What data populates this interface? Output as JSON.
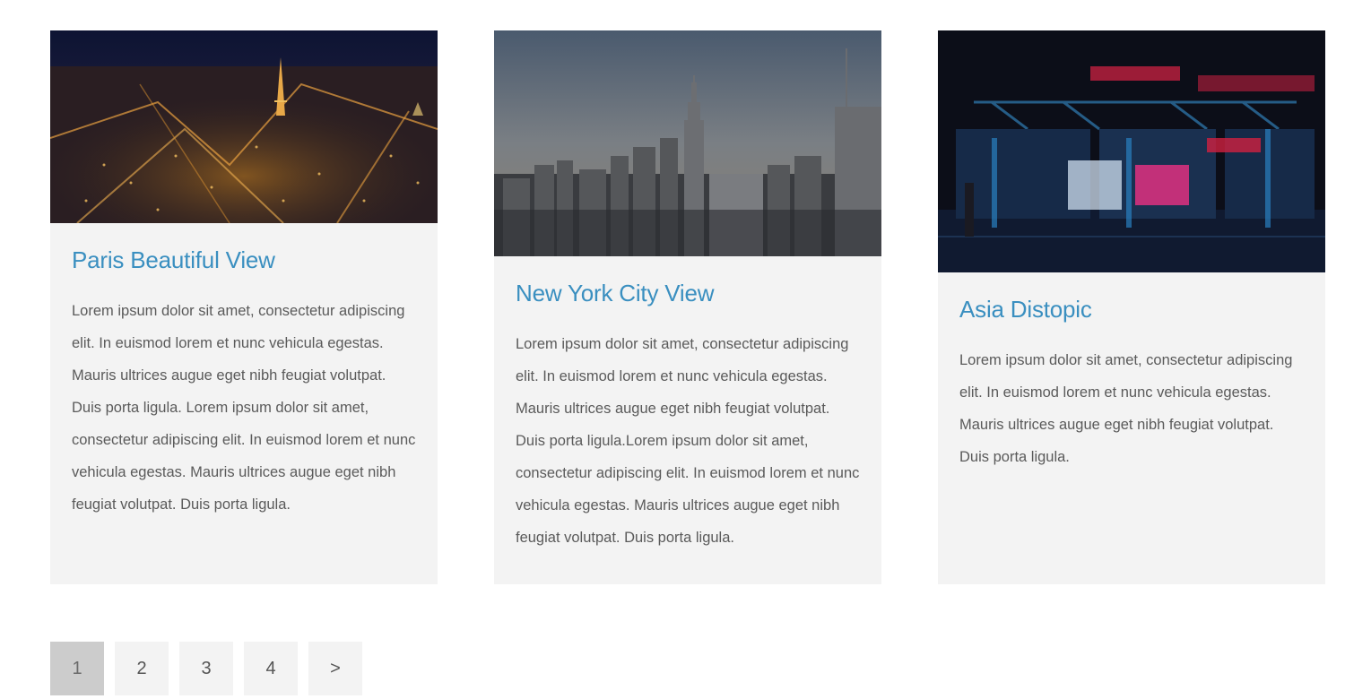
{
  "cards": [
    {
      "title": "Paris Beautiful View",
      "text": "Lorem ipsum dolor sit amet, consectetur adipiscing elit. In euismod lorem et nunc vehicula egestas. Mauris ultrices augue eget nibh feugiat volutpat. Duis porta ligula. Lorem ipsum dolor sit amet, consectetur adipiscing elit. In euismod lorem et nunc vehicula egestas. Mauris ultrices augue eget nibh feugiat volutpat. Duis porta ligula.",
      "image": "paris-night-cityscape"
    },
    {
      "title": "New York City View",
      "text": "Lorem ipsum dolor sit amet, consectetur adipiscing elit. In euismod lorem et nunc vehicula egestas. Mauris ultrices augue eget nibh feugiat volutpat. Duis porta ligula.Lorem ipsum dolor sit amet, consectetur adipiscing elit. In euismod lorem et nunc vehicula egestas. Mauris ultrices augue eget nibh feugiat volutpat. Duis porta ligula.",
      "image": "new-york-skyline"
    },
    {
      "title": "Asia Distopic",
      "text": "Lorem ipsum dolor sit amet, consectetur adipiscing elit. In euismod lorem et nunc vehicula egestas. Mauris ultrices augue eget nibh feugiat volutpat. Duis porta ligula.",
      "image": "neon-asian-street"
    }
  ],
  "pagination": {
    "pages": [
      "1",
      "2",
      "3",
      "4"
    ],
    "next_label": ">",
    "active_page": "1"
  },
  "colors": {
    "title": "#3a8fc0",
    "card_bg": "#f3f3f3",
    "active_page_bg": "#cccccc"
  }
}
